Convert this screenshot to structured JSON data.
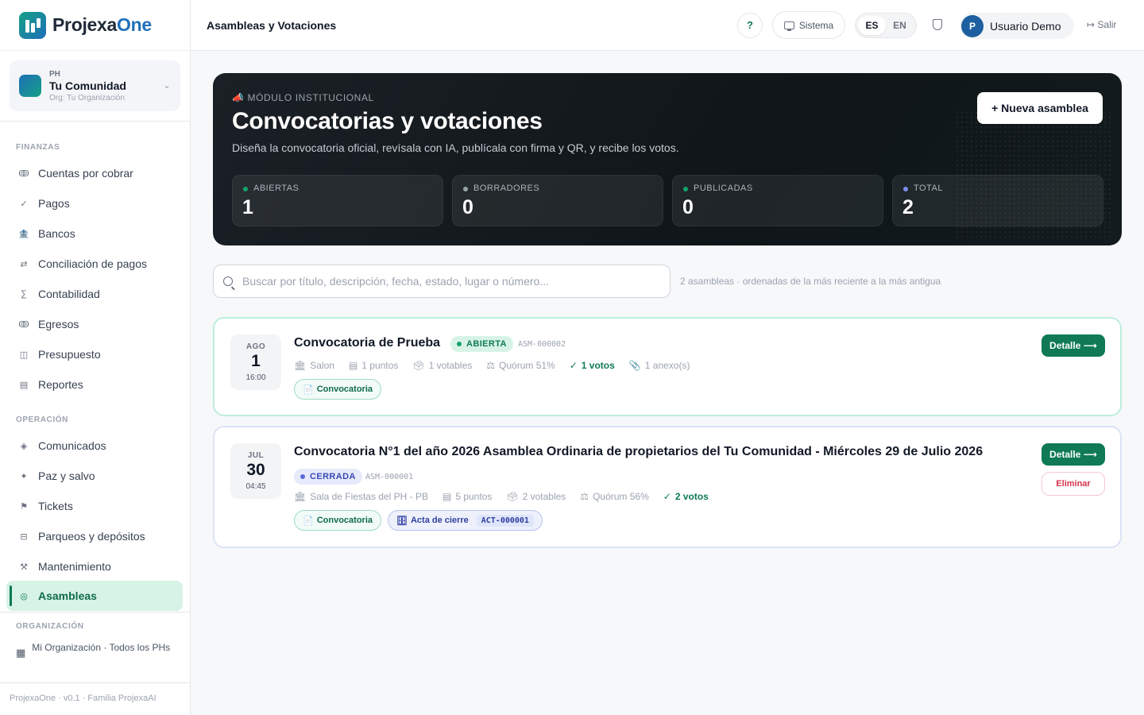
{
  "brand": {
    "name_main": "Projexa",
    "name_accent": "One"
  },
  "org": {
    "type": "PH",
    "name": "Tu Comunidad",
    "sub": "Org: Tu Organización"
  },
  "sidebar": {
    "finanzas_label": "FINANZAS",
    "finanzas": [
      {
        "icon": "ↂ",
        "label": "Cuentas por cobrar"
      },
      {
        "icon": "✓",
        "label": "Pagos"
      },
      {
        "icon": "🏦",
        "label": "Bancos"
      },
      {
        "icon": "⇄",
        "label": "Conciliación de pagos"
      },
      {
        "icon": "∑",
        "label": "Contabilidad"
      },
      {
        "icon": "ↂ",
        "label": "Egresos"
      },
      {
        "icon": "◫",
        "label": "Presupuesto"
      },
      {
        "icon": "▤",
        "label": "Reportes"
      }
    ],
    "operacion_label": "OPERACIÓN",
    "operacion": [
      {
        "icon": "◈",
        "label": "Comunicados"
      },
      {
        "icon": "✦",
        "label": "Paz y salvo"
      },
      {
        "icon": "⚑",
        "label": "Tickets"
      },
      {
        "icon": "⊟",
        "label": "Parqueos y depósitos"
      },
      {
        "icon": "⚒",
        "label": "Mantenimiento"
      },
      {
        "icon": "◎",
        "label": "Asambleas"
      }
    ],
    "organizacion_label": "ORGANIZACIÓN",
    "org_link": "Mi Organización · Todos los PHs",
    "footer": "ProjexaOne · v0.1 · Familia ProjexaAI"
  },
  "topbar": {
    "title": "Asambleas y Votaciones",
    "help": "?",
    "system": "Sistema",
    "lang_es": "ES",
    "lang_en": "EN",
    "user_initial": "P",
    "user_name": "Usuario Demo",
    "logout": "Salir"
  },
  "hero": {
    "kicker": "MÓDULO INSTITUCIONAL",
    "title": "Convocatorias y votaciones",
    "subtitle": "Diseña la convocatoria oficial, revísala con IA, publícala con firma y QR, y recibe los votos.",
    "new_button": "+ Nueva asamblea",
    "stats": [
      {
        "label": "ABIERTAS",
        "value": "1",
        "color": "#16a36b"
      },
      {
        "label": "BORRADORES",
        "value": "0",
        "color": "#9aa4ad"
      },
      {
        "label": "PUBLICADAS",
        "value": "0",
        "color": "#16a36b"
      },
      {
        "label": "TOTAL",
        "value": "2",
        "color": "#7b8cf0"
      }
    ]
  },
  "search": {
    "placeholder": "Buscar por título, descripción, fecha, estado, lugar o número...",
    "meta": "2 asambleas · ordenadas de la más reciente a la más antigua"
  },
  "assemblies": [
    {
      "month": "AGO",
      "day": "1",
      "time": "16:00",
      "title": "Convocatoria de Prueba",
      "status": "ABIERTA",
      "code": "ASM-000002",
      "place": "Salon",
      "points": "1 puntos",
      "voters": "1 votables",
      "quorum": "Quórum 51%",
      "votes": "1 votos",
      "annex": "1 anexo(s)",
      "chip": "Convocatoria",
      "detail": "Detalle ⟶"
    },
    {
      "month": "JUL",
      "day": "30",
      "time": "04:45",
      "title": "Convocatoria N°1 del año 2026 Asamblea Ordinaria de propietarios del Tu Comunidad - Miércoles 29 de Julio 2026",
      "status": "CERRADA",
      "code": "ASM-000001",
      "place": "Sala de Fiestas del PH - PB",
      "points": "5 puntos",
      "voters": "2 votables",
      "quorum": "Quórum 56%",
      "votes": "2 votos",
      "chip": "Convocatoria",
      "chip2": "Acta de cierre",
      "chip2_tag": "ACT-000001",
      "detail": "Detalle ⟶",
      "delete": "Eliminar"
    }
  ]
}
